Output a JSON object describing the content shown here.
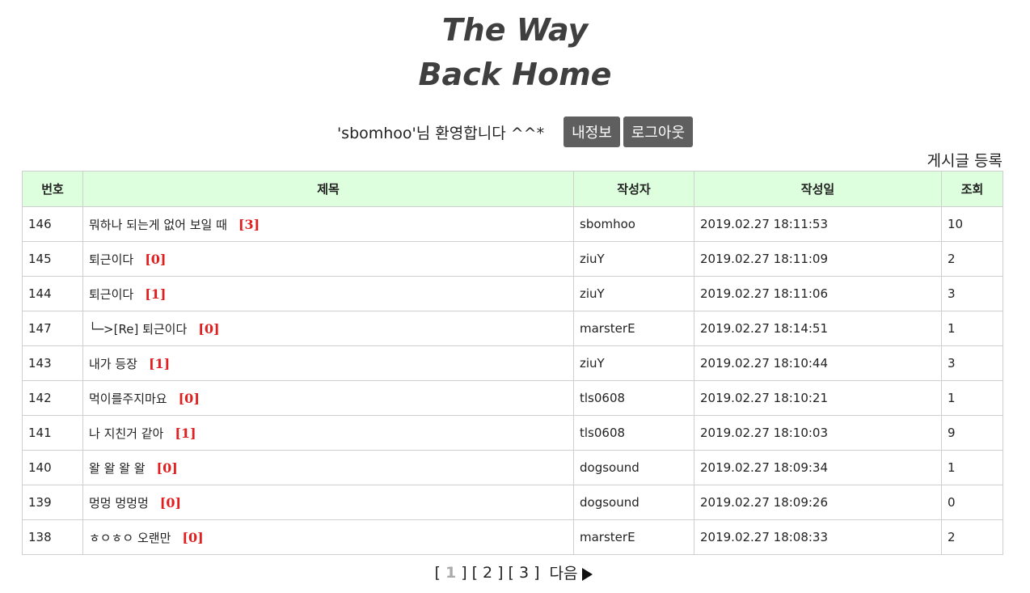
{
  "site": {
    "title_line1": "The Way",
    "title_line2": "Back Home"
  },
  "welcome": {
    "message": "'sbomhoo'님 환영합니다 ^^*",
    "my_info_label": "내정보",
    "logout_label": "로그아웃"
  },
  "register_label": "게시글 등록",
  "table": {
    "headers": [
      "번호",
      "제목",
      "작성자",
      "작성일",
      "조회"
    ],
    "rows": [
      {
        "no": "146",
        "title": "뭐하나 되는게 없어 보일 때",
        "replies": "[3]",
        "author": "sbomhoo",
        "date": "2019.02.27 18:11:53",
        "views": "10"
      },
      {
        "no": "145",
        "title": "퇴근이다",
        "replies": "[0]",
        "author": "ziuY",
        "date": "2019.02.27 18:11:09",
        "views": "2"
      },
      {
        "no": "144",
        "title": "퇴근이다",
        "replies": "[1]",
        "author": "ziuY",
        "date": "2019.02.27 18:11:06",
        "views": "3"
      },
      {
        "no": "147",
        "title": "└─>[Re] 퇴근이다",
        "replies": "[0]",
        "author": "marsterE",
        "date": "2019.02.27 18:14:51",
        "views": "1"
      },
      {
        "no": "143",
        "title": "내가 등장",
        "replies": "[1]",
        "author": "ziuY",
        "date": "2019.02.27 18:10:44",
        "views": "3"
      },
      {
        "no": "142",
        "title": "먹이를주지마요",
        "replies": "[0]",
        "author": "tls0608",
        "date": "2019.02.27 18:10:21",
        "views": "1"
      },
      {
        "no": "141",
        "title": "나 지친거 같아",
        "replies": "[1]",
        "author": "tls0608",
        "date": "2019.02.27 18:10:03",
        "views": "9"
      },
      {
        "no": "140",
        "title": "왈 왈 왈 왈",
        "replies": "[0]",
        "author": "dogsound",
        "date": "2019.02.27 18:09:34",
        "views": "1"
      },
      {
        "no": "139",
        "title": "멍멍 멍멍멍",
        "replies": "[0]",
        "author": "dogsound",
        "date": "2019.02.27 18:09:26",
        "views": "0"
      },
      {
        "no": "138",
        "title": "ㅎㅇㅎㅇ 오랜만",
        "replies": "[0]",
        "author": "marsterE",
        "date": "2019.02.27 18:08:33",
        "views": "2"
      }
    ]
  },
  "pagination": {
    "current": "1",
    "pages": [
      "2",
      "3"
    ],
    "next_label": "다음",
    "next_icon": "play-icon"
  }
}
